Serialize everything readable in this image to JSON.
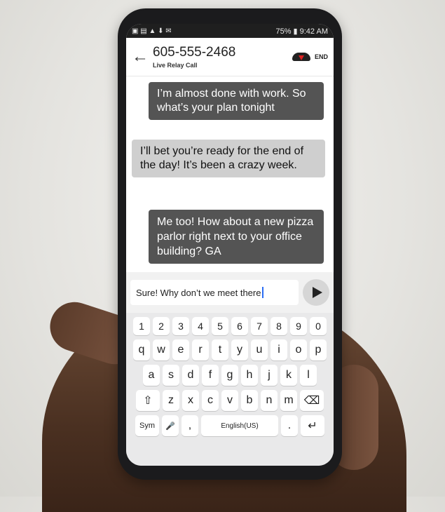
{
  "status_bar": {
    "icons_left": "▣ ▤ ▲ ⬇ ✉",
    "right": "75% ▮ 9:42 AM"
  },
  "header": {
    "phone_number": "605-555-2468",
    "subtitle": "Live Relay Call",
    "end_label": "END"
  },
  "messages": [
    {
      "dir": "out",
      "text": "I’m almost done with work. So what’s your plan tonight"
    },
    {
      "dir": "in",
      "text": "I’ll bet you’re ready for the end of the day! It’s been a crazy week."
    },
    {
      "dir": "out",
      "text": "Me too! How about a new pizza parlor right next to your office building? GA"
    }
  ],
  "composer": {
    "value": "Sure! Why don’t we meet there"
  },
  "keyboard": {
    "row_numbers": [
      "1",
      "2",
      "3",
      "4",
      "5",
      "6",
      "7",
      "8",
      "9",
      "0"
    ],
    "row1": [
      "q",
      "w",
      "e",
      "r",
      "t",
      "y",
      "u",
      "i",
      "o",
      "p"
    ],
    "row2": [
      "a",
      "s",
      "d",
      "f",
      "g",
      "h",
      "j",
      "k",
      "l"
    ],
    "row3": [
      "z",
      "x",
      "c",
      "v",
      "b",
      "n",
      "m"
    ],
    "shift": "⇧",
    "backspace": "⌫",
    "sym": "Sym",
    "mic": "🎤",
    "comma": ",",
    "space_label": "English(US)",
    "period": ".",
    "enter": "↵"
  }
}
